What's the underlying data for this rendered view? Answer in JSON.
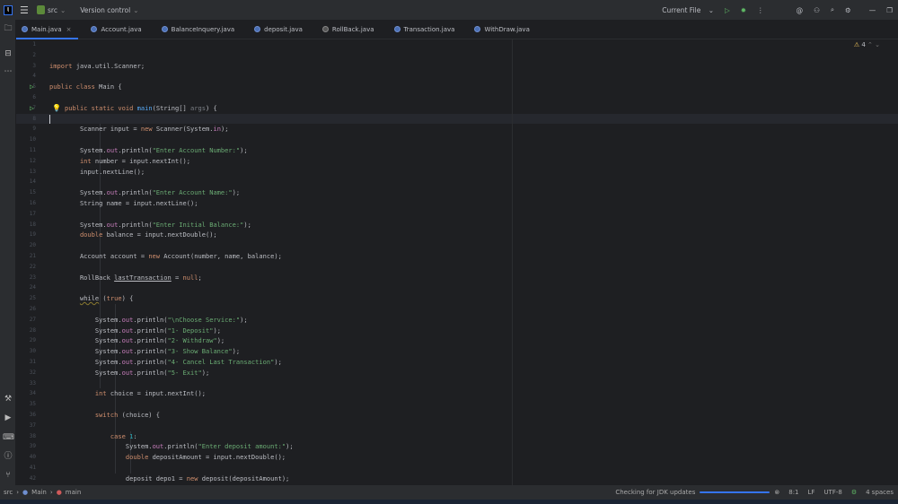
{
  "topbar": {
    "project": "src",
    "vcs": "Version control",
    "run_config": "Current File"
  },
  "tabs": [
    {
      "label": "Main.java",
      "active": true
    },
    {
      "label": "Account.java"
    },
    {
      "label": "BalanceInquery.java"
    },
    {
      "label": "deposit.java"
    },
    {
      "label": "RollBack.java"
    },
    {
      "label": "Transaction.java"
    },
    {
      "label": "WithDraw.java"
    }
  ],
  "inspections": {
    "warnings": "4"
  },
  "editor": {
    "current_line": 8,
    "lines": [
      [],
      [],
      [
        [
          "k",
          "import "
        ],
        [
          "p",
          "java.util.Scanner;"
        ]
      ],
      [],
      [
        [
          "k",
          "public class "
        ],
        [
          "p",
          "Main {"
        ]
      ],
      [],
      [
        [
          "k",
          "    public static void "
        ],
        [
          "m",
          "main"
        ],
        [
          "p",
          "(String[] "
        ],
        [
          "c",
          "args"
        ],
        [
          "p",
          ") {"
        ]
      ],
      [],
      [
        [
          "p",
          "        Scanner input = "
        ],
        [
          "k",
          "new "
        ],
        [
          "p",
          "Scanner(System."
        ],
        [
          "f",
          "in"
        ],
        [
          "p",
          ");"
        ]
      ],
      [],
      [
        [
          "p",
          "        System."
        ],
        [
          "f",
          "out"
        ],
        [
          "p",
          ".println("
        ],
        [
          "s",
          "\"Enter Account Number:\""
        ],
        [
          "p",
          ");"
        ]
      ],
      [
        [
          "k",
          "        int "
        ],
        [
          "p",
          "number = input.nextInt();"
        ]
      ],
      [
        [
          "p",
          "        input.nextLine();"
        ]
      ],
      [],
      [
        [
          "p",
          "        System."
        ],
        [
          "f",
          "out"
        ],
        [
          "p",
          ".println("
        ],
        [
          "s",
          "\"Enter Account Name:\""
        ],
        [
          "p",
          ");"
        ]
      ],
      [
        [
          "p",
          "        String name = input.nextLine();"
        ]
      ],
      [],
      [
        [
          "p",
          "        System."
        ],
        [
          "f",
          "out"
        ],
        [
          "p",
          ".println("
        ],
        [
          "s",
          "\"Enter Initial Balance:\""
        ],
        [
          "p",
          ");"
        ]
      ],
      [
        [
          "k",
          "        double "
        ],
        [
          "p",
          "balance = input.nextDouble();"
        ]
      ],
      [],
      [
        [
          "p",
          "        Account account = "
        ],
        [
          "k",
          "new "
        ],
        [
          "p",
          "Account(number, name, balance);"
        ]
      ],
      [],
      [
        [
          "p",
          "        RollBack "
        ],
        [
          "u",
          "lastTransaction"
        ],
        [
          "p",
          " = "
        ],
        [
          "k",
          "null"
        ],
        [
          "p",
          ";"
        ]
      ],
      [],
      [
        [
          "p",
          "        "
        ],
        [
          "w",
          "while"
        ],
        [
          "p",
          " ("
        ],
        [
          "k",
          "true"
        ],
        [
          "p",
          ") {"
        ]
      ],
      [],
      [
        [
          "p",
          "            System."
        ],
        [
          "f",
          "out"
        ],
        [
          "p",
          ".println("
        ],
        [
          "s",
          "\"\\nChoose Service:\""
        ],
        [
          "p",
          ");"
        ]
      ],
      [
        [
          "p",
          "            System."
        ],
        [
          "f",
          "out"
        ],
        [
          "p",
          ".println("
        ],
        [
          "s",
          "\"1- Deposit\""
        ],
        [
          "p",
          ");"
        ]
      ],
      [
        [
          "p",
          "            System."
        ],
        [
          "f",
          "out"
        ],
        [
          "p",
          ".println("
        ],
        [
          "s",
          "\"2- Withdraw\""
        ],
        [
          "p",
          ");"
        ]
      ],
      [
        [
          "p",
          "            System."
        ],
        [
          "f",
          "out"
        ],
        [
          "p",
          ".println("
        ],
        [
          "s",
          "\"3- Show Balance\""
        ],
        [
          "p",
          ");"
        ]
      ],
      [
        [
          "p",
          "            System."
        ],
        [
          "f",
          "out"
        ],
        [
          "p",
          ".println("
        ],
        [
          "s",
          "\"4- Cancel Last Transaction\""
        ],
        [
          "p",
          ");"
        ]
      ],
      [
        [
          "p",
          "            System."
        ],
        [
          "f",
          "out"
        ],
        [
          "p",
          ".println("
        ],
        [
          "s",
          "\"5- Exit\""
        ],
        [
          "p",
          ");"
        ]
      ],
      [],
      [
        [
          "k",
          "            int "
        ],
        [
          "p",
          "choice = input.nextInt();"
        ]
      ],
      [],
      [
        [
          "k",
          "            switch "
        ],
        [
          "p",
          "(choice) {"
        ]
      ],
      [],
      [
        [
          "k",
          "                case "
        ],
        [
          "n",
          "1"
        ],
        [
          "p",
          ":"
        ]
      ],
      [
        [
          "p",
          "                    System."
        ],
        [
          "f",
          "out"
        ],
        [
          "p",
          ".println("
        ],
        [
          "s",
          "\"Enter deposit amount:\""
        ],
        [
          "p",
          ");"
        ]
      ],
      [
        [
          "k",
          "                    double "
        ],
        [
          "p",
          "depositAmount = input.nextDouble();"
        ]
      ],
      [],
      [
        [
          "p",
          "                    deposit depo1 = "
        ],
        [
          "k",
          "new "
        ],
        [
          "p",
          "deposit(depositAmount);"
        ]
      ]
    ]
  },
  "status": {
    "breadcrumb": [
      "src",
      "Main",
      "main"
    ],
    "task": "Checking for JDK updates",
    "task_progress": 1.0,
    "position": "8:1",
    "line_sep": "LF",
    "encoding": "UTF-8",
    "indent": "4 spaces"
  }
}
